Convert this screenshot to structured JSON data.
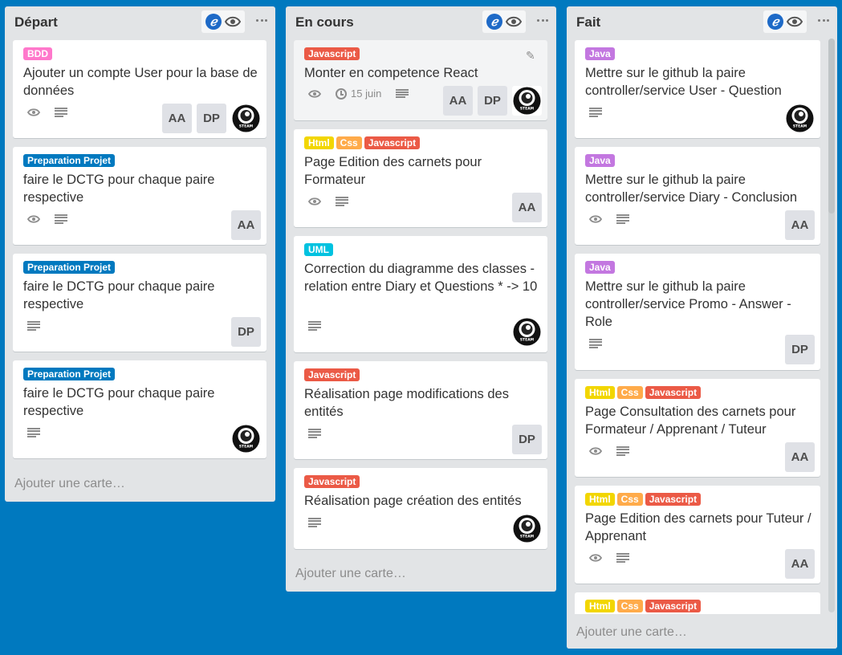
{
  "lists": [
    {
      "title": "Départ",
      "add_card": "Ajouter une carte…",
      "cards": [
        {
          "labels": [
            {
              "text": "BDD",
              "color": "#ff78cb"
            }
          ],
          "title": "Ajouter un compte User pour la base de données",
          "members": [
            "AA",
            "DP",
            "steam-avatar"
          ]
        },
        {
          "labels": [
            {
              "text": "Preparation Projet",
              "color": "#0079bf"
            }
          ],
          "title": "faire le DCTG pour chaque paire respective",
          "members": [
            "AA"
          ]
        },
        {
          "labels": [
            {
              "text": "Preparation Projet",
              "color": "#0079bf"
            }
          ],
          "title": "faire le DCTG pour chaque paire respective",
          "members": [
            "DP"
          ]
        },
        {
          "labels": [
            {
              "text": "Preparation Projet",
              "color": "#0079bf"
            }
          ],
          "title": "faire le DCTG pour chaque paire respective",
          "members": [
            "steam-avatar"
          ]
        }
      ]
    },
    {
      "title": "En cours",
      "add_card": "Ajouter une carte…",
      "cards": [
        {
          "labels": [
            {
              "text": "Javascript",
              "color": "#eb5a46"
            }
          ],
          "title": "Monter en competence React",
          "due": "15 juin",
          "members": [
            "AA",
            "DP",
            "steam-avatar"
          ]
        },
        {
          "labels": [
            {
              "text": "Html",
              "color": "#f2d600"
            },
            {
              "text": "Css",
              "color": "#ffab4a"
            },
            {
              "text": "Javascript",
              "color": "#eb5a46"
            }
          ],
          "title": "Page Edition des carnets pour Formateur",
          "members": [
            "AA"
          ]
        },
        {
          "labels": [
            {
              "text": "UML",
              "color": "#00c2e0"
            }
          ],
          "title": "Correction du diagramme des classes - relation entre Diary et Questions * -> 10",
          "members": [
            "steam-avatar"
          ]
        },
        {
          "labels": [
            {
              "text": "Javascript",
              "color": "#eb5a46"
            }
          ],
          "title": "Réalisation page modifications des entités",
          "members": [
            "DP"
          ]
        },
        {
          "labels": [
            {
              "text": "Javascript",
              "color": "#eb5a46"
            }
          ],
          "title": "Réalisation page création des entités",
          "members": [
            "steam-avatar"
          ]
        }
      ]
    },
    {
      "title": "Fait",
      "add_card": "Ajouter une carte…",
      "cards": [
        {
          "labels": [
            {
              "text": "Java",
              "color": "#c377e0"
            }
          ],
          "title": "Mettre sur le github la paire controller/service User - Question",
          "members": [
            "steam-avatar"
          ]
        },
        {
          "labels": [
            {
              "text": "Java",
              "color": "#c377e0"
            }
          ],
          "title": "Mettre sur le github la paire controller/service Diary - Conclusion",
          "members": [
            "AA"
          ]
        },
        {
          "labels": [
            {
              "text": "Java",
              "color": "#c377e0"
            }
          ],
          "title": "Mettre sur le github la paire controller/service Promo - Answer - Role",
          "members": [
            "DP"
          ]
        },
        {
          "labels": [
            {
              "text": "Html",
              "color": "#f2d600"
            },
            {
              "text": "Css",
              "color": "#ffab4a"
            },
            {
              "text": "Javascript",
              "color": "#eb5a46"
            }
          ],
          "title": "Page Consultation des carnets pour Formateur / Apprenant / Tuteur",
          "members": [
            "AA"
          ]
        },
        {
          "labels": [
            {
              "text": "Html",
              "color": "#f2d600"
            },
            {
              "text": "Css",
              "color": "#ffab4a"
            },
            {
              "text": "Javascript",
              "color": "#eb5a46"
            }
          ],
          "title": "Page Edition des carnets pour Tuteur / Apprenant",
          "members": [
            "AA"
          ]
        },
        {
          "labels": [
            {
              "text": "Html",
              "color": "#f2d600"
            },
            {
              "text": "Css",
              "color": "#ffab4a"
            },
            {
              "text": "Javascript",
              "color": "#eb5a46"
            }
          ],
          "title": "",
          "members": []
        }
      ]
    }
  ],
  "colors": {
    "board_bg": "#0079bf",
    "list_bg": "#e2e4e6",
    "card_bg": "#ffffff"
  }
}
